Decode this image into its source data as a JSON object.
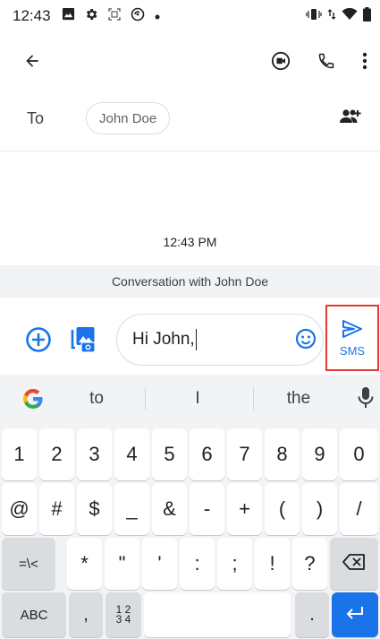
{
  "status_bar": {
    "time": "12:43"
  },
  "header": {
    "back_icon": "arrow-left-icon",
    "video_icon": "video-call-icon",
    "call_icon": "phone-icon",
    "more_icon": "more-vert-icon"
  },
  "recipient": {
    "to_label": "To",
    "chip": "John Doe"
  },
  "thread": {
    "timestamp": "12:43 PM",
    "conversation_label": "Conversation with John Doe"
  },
  "compose": {
    "message_value": "Hi John,",
    "send_label": "SMS"
  },
  "keyboard": {
    "suggestions": [
      "to",
      "I",
      "the"
    ],
    "row1": [
      "1",
      "2",
      "3",
      "4",
      "5",
      "6",
      "7",
      "8",
      "9",
      "0"
    ],
    "row2": [
      "@",
      "#",
      "$",
      "_",
      "&",
      "-",
      "+",
      "(",
      ")",
      "/"
    ],
    "row3_fn": "=\\<",
    "row3": [
      "*",
      "\"",
      "'",
      ":",
      ";",
      "!",
      "?"
    ],
    "abc": "ABC",
    "comma": ",",
    "numpad": "1 2\n3 4",
    "period": "."
  },
  "colors": {
    "accent": "#1a73e8",
    "highlight": "#e53935"
  }
}
